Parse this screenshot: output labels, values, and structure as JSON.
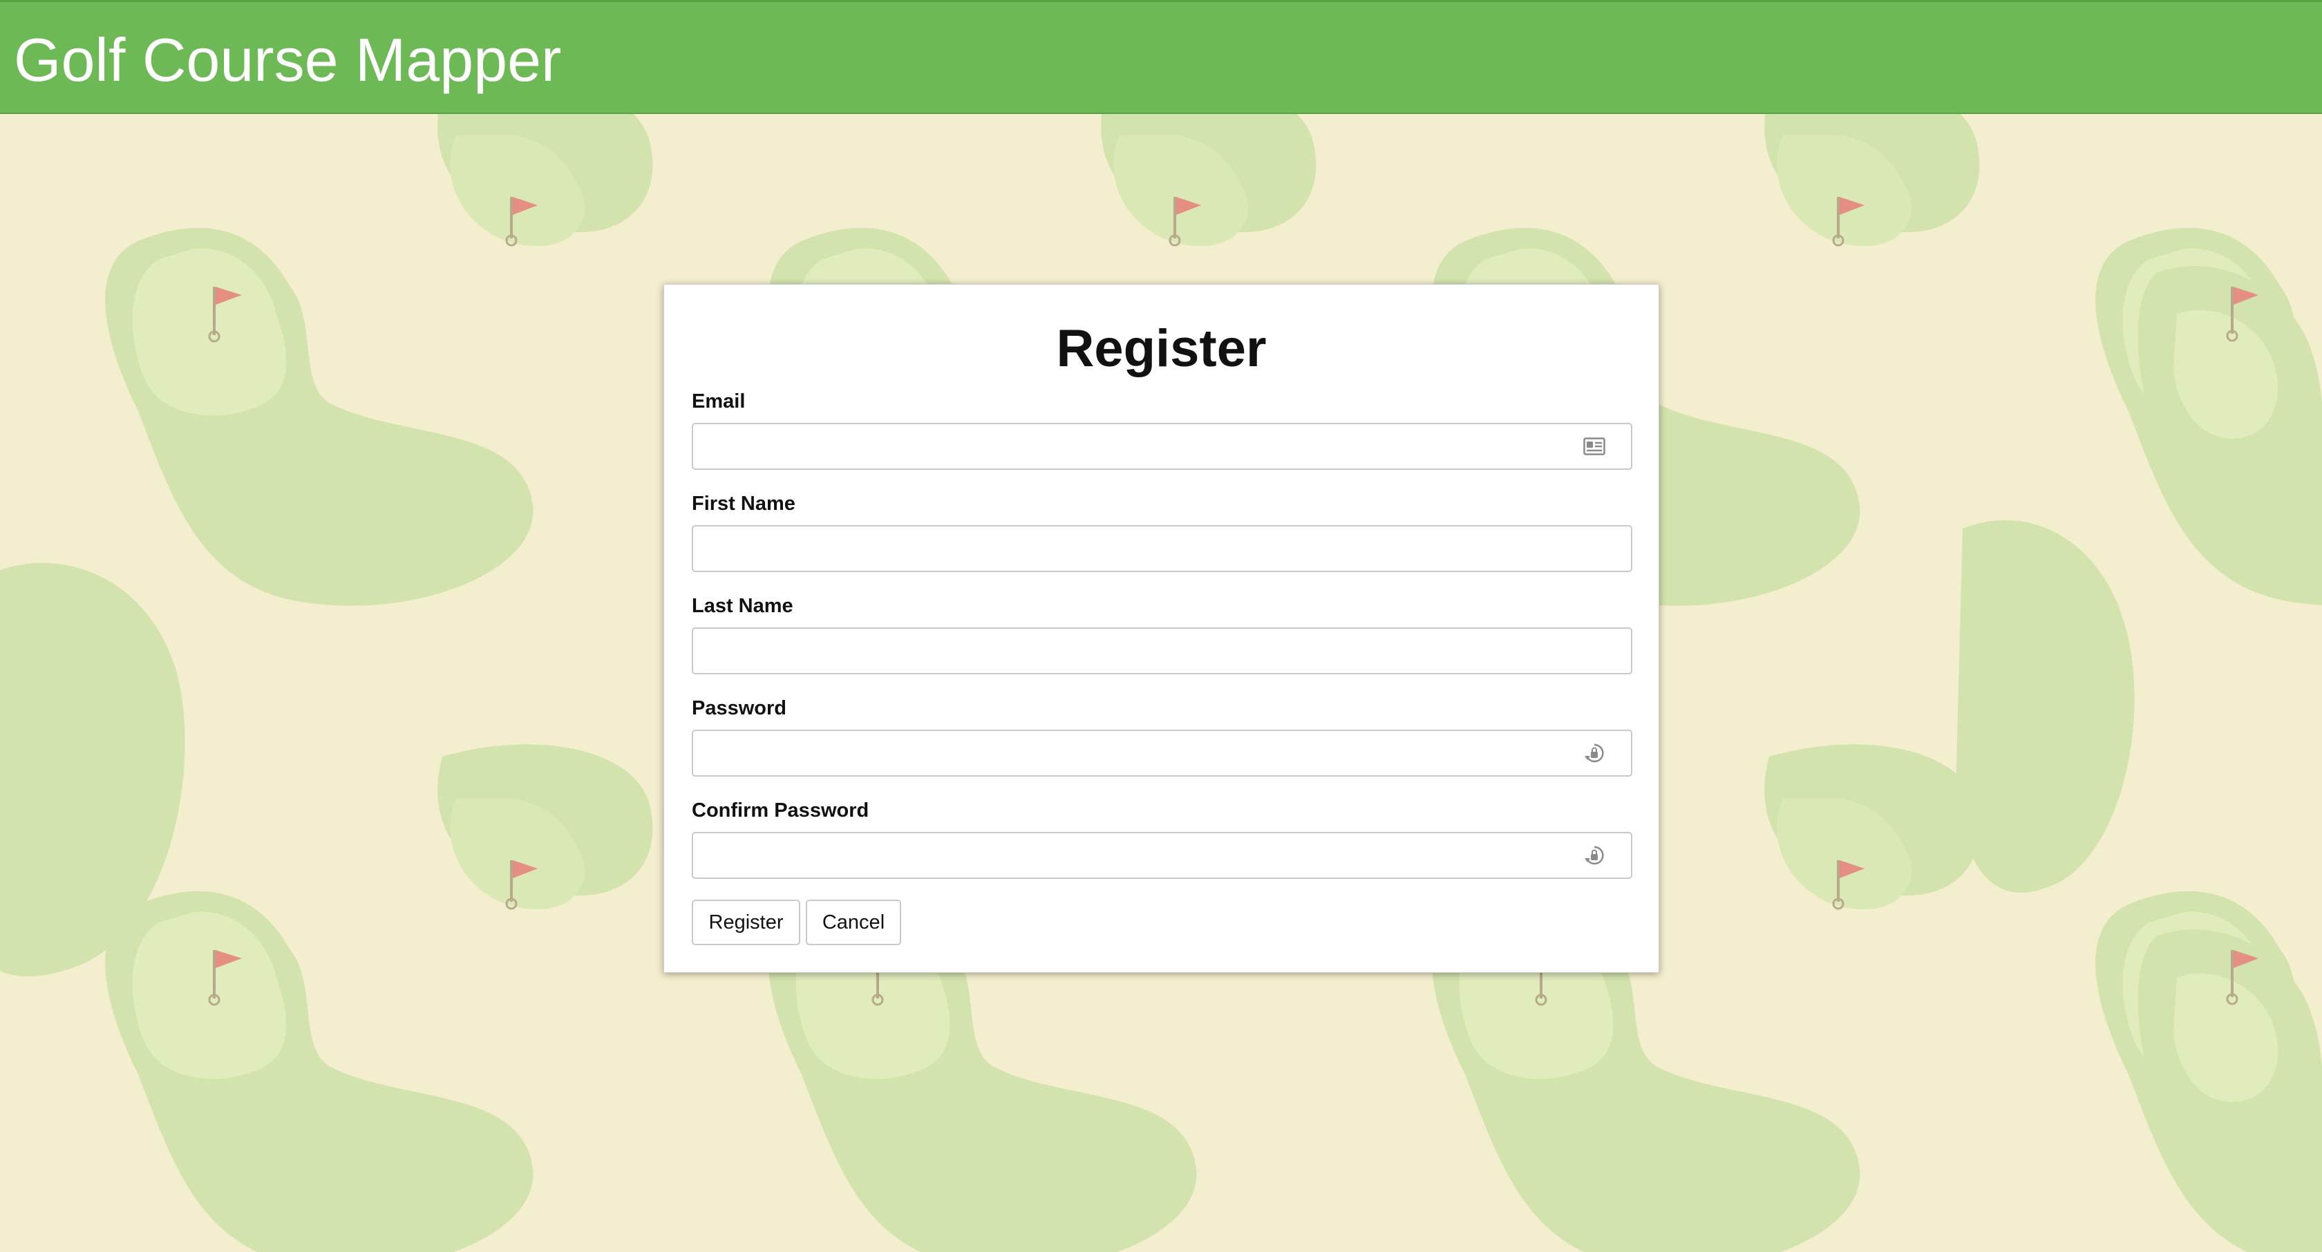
{
  "header": {
    "title": "Golf Course Mapper",
    "background_color": "#6cb955"
  },
  "background": {
    "base_color": "#f3eecd",
    "pattern": "golf green blobs with red flags"
  },
  "register_form": {
    "title": "Register",
    "fields": [
      {
        "label": "Email",
        "value": "",
        "placeholder": "",
        "icon": "contact-card-icon"
      },
      {
        "label": "First Name",
        "value": "",
        "placeholder": ""
      },
      {
        "label": "Last Name",
        "value": "",
        "placeholder": ""
      },
      {
        "label": "Password",
        "value": "",
        "placeholder": "",
        "icon": "password-key-icon"
      },
      {
        "label": "Confirm Password",
        "value": "",
        "placeholder": "",
        "icon": "password-key-icon"
      }
    ],
    "buttons": {
      "register_label": "Register",
      "cancel_label": "Cancel"
    }
  }
}
